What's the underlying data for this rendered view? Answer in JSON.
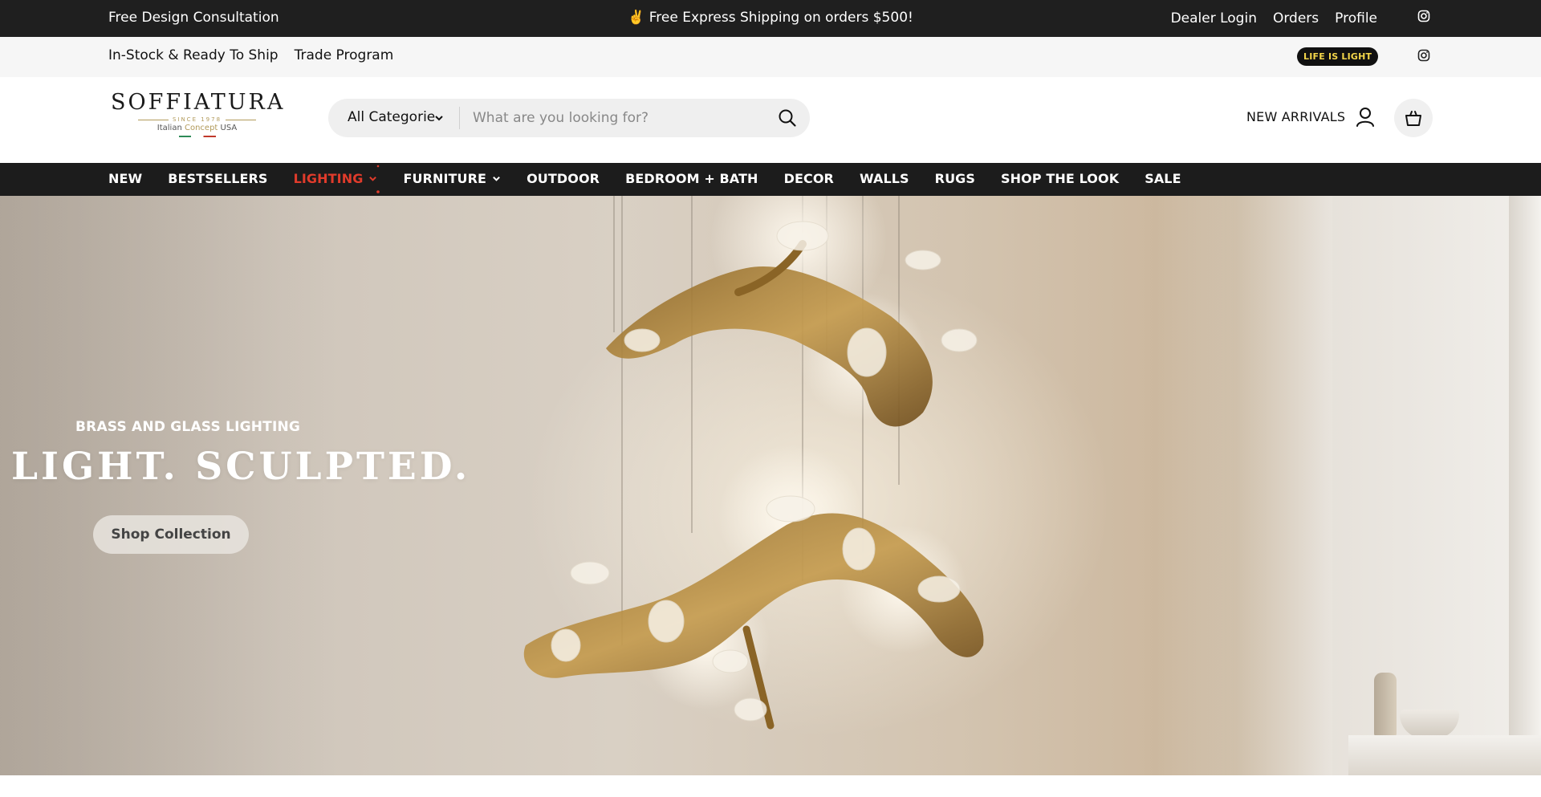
{
  "topbar": {
    "left_text": "Free Design Consultation",
    "center_text": "✌️ Free Express Shipping on orders $500!",
    "links": [
      "Dealer Login",
      "Orders",
      "Profile"
    ],
    "social_icon": "instagram-icon"
  },
  "subbar": {
    "links": [
      "In-Stock & Ready To Ship",
      "Trade Program"
    ],
    "badge": "LIFE IS LIGHT",
    "social_icon": "instagram-icon"
  },
  "header": {
    "logo": {
      "wordmark": "SOFFIATURA",
      "since": "SINCE 1978",
      "tag_prefix": "Italian",
      "tag_accent": "Concept",
      "tag_suffix": "USA"
    },
    "search": {
      "category": "All Categories",
      "placeholder": "What are you looking for?",
      "value": ""
    },
    "new_arrivals": "NEW ARRIVALS",
    "icons": [
      "user-icon",
      "shopping-bag-icon",
      "search-icon",
      "chevron-down-icon"
    ]
  },
  "nav": {
    "items": [
      {
        "label": "NEW",
        "dropdown": false,
        "active": false
      },
      {
        "label": "BESTSELLERS",
        "dropdown": false,
        "active": false
      },
      {
        "label": "LIGHTING",
        "dropdown": true,
        "active": true
      },
      {
        "label": "FURNITURE",
        "dropdown": true,
        "active": false
      },
      {
        "label": "OUTDOOR",
        "dropdown": false,
        "active": false
      },
      {
        "label": "BEDROOM + BATH",
        "dropdown": false,
        "active": false
      },
      {
        "label": "DECOR",
        "dropdown": false,
        "active": false
      },
      {
        "label": "WALLS",
        "dropdown": false,
        "active": false
      },
      {
        "label": "RUGS",
        "dropdown": false,
        "active": false
      },
      {
        "label": "SHOP THE LOOK",
        "dropdown": false,
        "active": false
      },
      {
        "label": "SALE",
        "dropdown": false,
        "active": false
      }
    ],
    "active_color": "#e03b2b"
  },
  "hero": {
    "eyebrow": "BRASS AND GLASS LIGHTING",
    "headline": "LIGHT. SCULPTED.",
    "cta": "Shop Collection",
    "image_subject": "brass branch chandelier with glass birds"
  },
  "colors": {
    "topbar_bg": "#1f1f1f",
    "nav_bg": "#1c1c1c",
    "badge_bg": "#111111",
    "badge_text": "#f3d64a",
    "brand_gold": "#b29a5a"
  }
}
